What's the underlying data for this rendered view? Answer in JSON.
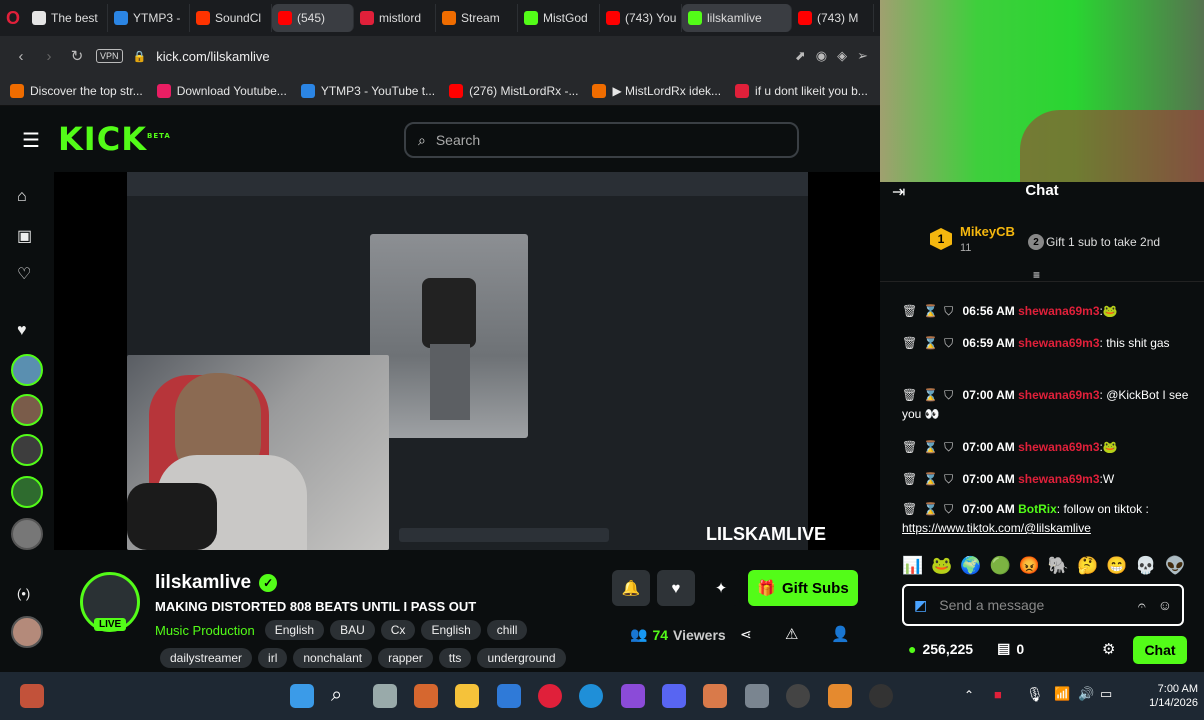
{
  "tabs": [
    {
      "label": "The best",
      "color": "#e5e5e5"
    },
    {
      "label": "YTMP3 -",
      "color": "#2b85e4"
    },
    {
      "label": "SoundCl",
      "color": "#ff3300"
    },
    {
      "label": "(545)",
      "color": "#ff0000",
      "active": true
    },
    {
      "label": "mistlord",
      "color": "#e0203a"
    },
    {
      "label": "Stream",
      "color": "#ef6c00"
    },
    {
      "label": "MistGod",
      "color": "#53fc18"
    },
    {
      "label": "(743) You",
      "color": "#ff0000"
    },
    {
      "label": "lilskamlive",
      "color": "#53fc18",
      "active": true
    },
    {
      "label": "(743) M",
      "color": "#ff0000"
    }
  ],
  "address": {
    "vpn": "VPN",
    "url": "kick.com/lilskamlive"
  },
  "bookmarks": [
    {
      "label": "Discover the top str...",
      "color": "#ef6c00"
    },
    {
      "label": "Download Youtube...",
      "color": "#e91e63"
    },
    {
      "label": "YTMP3 - YouTube t...",
      "color": "#2b85e4"
    },
    {
      "label": "(276) MistLordRx -...",
      "color": "#ff0000"
    },
    {
      "label": "▶ MistLordRx idek...",
      "color": "#ef6c00"
    },
    {
      "label": "if u dont likeit you b...",
      "color": "#e0203a"
    }
  ],
  "kick": {
    "logo": "KICK",
    "beta": "BETA",
    "search_placeholder": "Search"
  },
  "video": {
    "watermark": "LILSKAMLIVE"
  },
  "stream": {
    "channel": "lilskamlive",
    "live_badge": "LIVE",
    "title": "MAKING DISTORTED 808 BEATS UNTIL I PASS OUT",
    "category": "Music Production",
    "tags_row1": [
      "English",
      "BAU",
      "Cx",
      "English",
      "chill"
    ],
    "tags_row2": [
      "dailystreamer",
      "irl",
      "nonchalant",
      "rapper",
      "tts",
      "underground"
    ],
    "viewers": "74",
    "viewers_label": "Viewers",
    "gift_label": "Gift Subs"
  },
  "chat": {
    "header": "Chat",
    "leader": {
      "rank": "1",
      "name": "MikeyCB",
      "count": "11",
      "gift_rank": "2",
      "gift_text": "Gift 1 sub to take 2nd"
    },
    "messages": [
      {
        "time": "06:56 AM",
        "user": "shewana69m3",
        "sep": ":",
        "text": "🐸"
      },
      {
        "time": "06:59 AM",
        "user": "shewana69m3",
        "sep": ":",
        "text": " this shit gas"
      },
      {
        "time": "07:00 AM",
        "user": "shewana69m3",
        "sep": ":",
        "text": " @KickBot I see you 👀"
      },
      {
        "time": "07:00 AM",
        "user": "shewana69m3",
        "sep": ":",
        "text": "🐸"
      },
      {
        "time": "07:00 AM",
        "user": "shewana69m3",
        "sep": ":",
        "text": "W"
      },
      {
        "time": "07:00 AM",
        "user": "BotRix",
        "sep": ":",
        "text": " follow on tiktok : ",
        "link": "https://www.tiktok.com/@lilskamlive"
      }
    ],
    "input_placeholder": "Send a message",
    "points": "256,225",
    "drops": "0",
    "send_label": "Chat"
  },
  "taskbar": {
    "time": "7:00 AM",
    "date": "1/14/2026"
  }
}
